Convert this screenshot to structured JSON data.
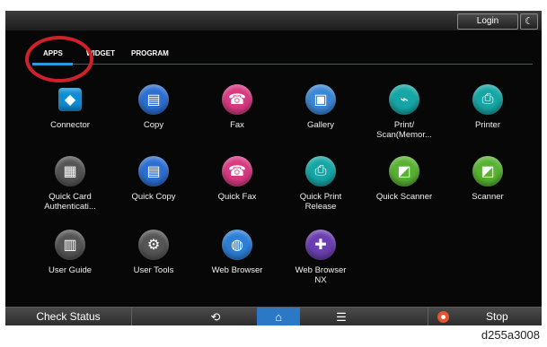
{
  "topbar": {
    "login_label": "Login",
    "moon_icon": "moon-icon"
  },
  "tabs": [
    {
      "label": "APPS",
      "active": true
    },
    {
      "label": "WIDGET",
      "active": false
    },
    {
      "label": "PROGRAM",
      "active": false
    }
  ],
  "apps": [
    {
      "label": "Connector",
      "icon": "connector-icon",
      "color": "#c8186a"
    },
    {
      "label": "Copy",
      "icon": "copy-icon",
      "color": "#2d6fd1"
    },
    {
      "label": "Fax",
      "icon": "fax-icon",
      "color": "#d93a82"
    },
    {
      "label": "Gallery",
      "icon": "gallery-icon",
      "color": "#3b86d6"
    },
    {
      "label": "Print/\nScan(Memor...",
      "icon": "usb-icon",
      "color": "#17a6a6"
    },
    {
      "label": "Printer",
      "icon": "printer-icon",
      "color": "#17a6a6"
    },
    {
      "label": "Quick Card\nAuthenticati...",
      "icon": "card-icon",
      "color": "#555555"
    },
    {
      "label": "Quick Copy",
      "icon": "copy-icon",
      "color": "#2d6fd1"
    },
    {
      "label": "Quick Fax",
      "icon": "fax-icon",
      "color": "#d93a82"
    },
    {
      "label": "Quick Print\nRelease",
      "icon": "print-release-icon",
      "color": "#17a6a6"
    },
    {
      "label": "Quick Scanner",
      "icon": "scanner-icon",
      "color": "#58b332"
    },
    {
      "label": "Scanner",
      "icon": "scanner-icon",
      "color": "#58b332"
    },
    {
      "label": "User Guide",
      "icon": "book-icon",
      "color": "#555555"
    },
    {
      "label": "User Tools",
      "icon": "gears-icon",
      "color": "#555555"
    },
    {
      "label": "Web Browser",
      "icon": "globe-icon",
      "color": "#2d7fd6"
    },
    {
      "label": "Web Browser\nNX",
      "icon": "puzzle-icon",
      "color": "#6a3fb0"
    }
  ],
  "bottombar": {
    "check_status_label": "Check Status",
    "back_glyph": "⟲",
    "home_glyph": "⌂",
    "menu_glyph": "☰",
    "stop_label": "Stop"
  },
  "caption": "d255a3008"
}
